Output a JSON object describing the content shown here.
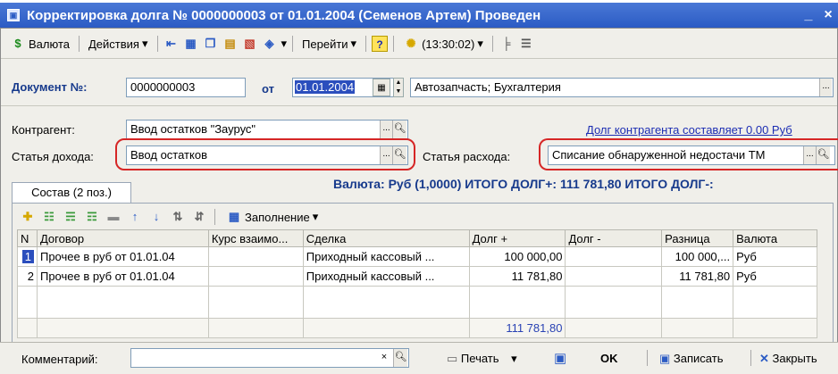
{
  "window": {
    "title": "Корректировка долга № 0000000003 от 01.01.2004 (Семенов Артем) Проведен",
    "minimize": "_",
    "close": "×"
  },
  "toolbar": {
    "currency": "Валюта",
    "actions": "Действия",
    "goto": "Перейти",
    "help": "?",
    "time": "(13:30:02)"
  },
  "header": {
    "doc_label": "Документ №:",
    "doc_number": "0000000003",
    "from_label": "от",
    "date": "01.01.2004",
    "org": "Автозапчасть; Бухгалтерия"
  },
  "form": {
    "counterparty_label": "Контрагент:",
    "counterparty_value": "Ввод остатков \"Заурус\"",
    "debt_link": "Долг контрагента составляет 0.00 Руб",
    "income_label": "Статья дохода:",
    "income_value": "Ввод остатков",
    "expense_label": "Статья расхода:",
    "expense_value": "Списание обнаруженной недостачи ТМ"
  },
  "tab": {
    "label": "Состав (2 поз.)"
  },
  "summary": {
    "text": "Валюта: Руб (1,0000)   ИТОГО ДОЛГ+: 111 781,80  ИТОГО ДОЛГ-:"
  },
  "table_toolbar": {
    "fill": "Заполнение"
  },
  "table": {
    "columns": [
      "N",
      "Договор",
      "Курс взаимо...",
      "Сделка",
      "Долг +",
      "Долг -",
      "Разница",
      "Валюта"
    ],
    "rows": [
      {
        "n": "1",
        "contract": "Прочее в руб от 01.01.04",
        "rate": "",
        "deal": "Приходный кассовый ...",
        "debit": "100 000,00",
        "credit": "",
        "diff": "100 000,...",
        "currency": "Руб"
      },
      {
        "n": "2",
        "contract": "Прочее в руб от 01.01.04",
        "rate": "",
        "deal": "Приходный кассовый ...",
        "debit": "11 781,80",
        "credit": "",
        "diff": "11 781,80",
        "currency": "Руб"
      }
    ],
    "total_debit": "111 781,80"
  },
  "bottom": {
    "comment_label": "Комментарий:",
    "print": "Печать",
    "ok": "OK",
    "save": "Записать",
    "close": "Закрыть"
  },
  "colors": {
    "titlebar": "#2b5bc4",
    "accent_text": "#173a8c",
    "highlight": "#d62626"
  }
}
